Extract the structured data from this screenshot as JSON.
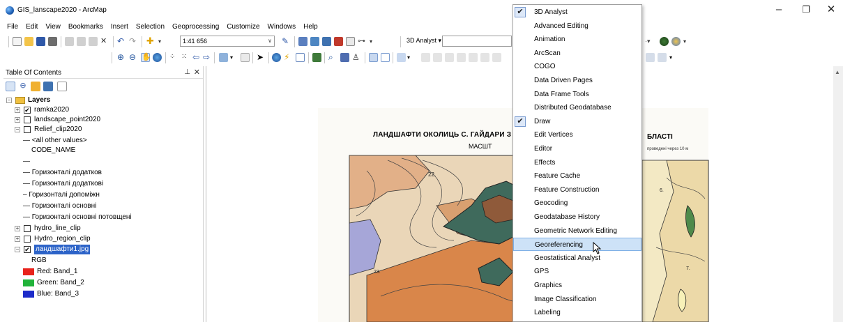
{
  "window": {
    "title": "GIS_lanscape2020 - ArcMap",
    "minimize": "–",
    "restore": "❐",
    "close": "✕"
  },
  "menubar": [
    "File",
    "Edit",
    "View",
    "Bookmarks",
    "Insert",
    "Selection",
    "Geoprocessing",
    "Customize",
    "Windows",
    "Help"
  ],
  "toolbar": {
    "scale_value": "1:41 656",
    "analyst_label": "3D Analyst ▾"
  },
  "toc": {
    "title": "Table Of Contents",
    "pin": "⊥",
    "close": "✕",
    "rows": [
      {
        "label": "Layers",
        "indent": 0,
        "expander": "−",
        "checkbox": "",
        "bold": true
      },
      {
        "label": "ramka2020",
        "indent": 1,
        "expander": "+",
        "checkbox": "✔"
      },
      {
        "label": "landscape_point2020",
        "indent": 1,
        "expander": "+",
        "checkbox": " "
      },
      {
        "label": "Relief_clip2020",
        "indent": 1,
        "expander": "−",
        "checkbox": " "
      },
      {
        "label": "— <all other values>",
        "indent": 2
      },
      {
        "label": "CODE_NAME",
        "indent": 3
      },
      {
        "label": "—",
        "indent": 2
      },
      {
        "label": "— Горизонталі додатков",
        "indent": 2
      },
      {
        "label": "— Горизонталі додаткові",
        "indent": 2
      },
      {
        "label": "– Горизонталі допоміжн",
        "indent": 2
      },
      {
        "label": "— Горизонталі основні",
        "indent": 2
      },
      {
        "label": "— Горизонталі основні потовщені",
        "indent": 2
      },
      {
        "label": "hydro_line_clip",
        "indent": 1,
        "expander": "+",
        "checkbox": " "
      },
      {
        "label": "Hydro_region_clip",
        "indent": 1,
        "expander": "+",
        "checkbox": " "
      },
      {
        "label": "ландшафти1.jpg",
        "indent": 1,
        "expander": "−",
        "checkbox": "✔",
        "selected": true
      },
      {
        "label": "RGB",
        "indent": 3
      },
      {
        "label": "Red:   Band_1",
        "indent": 2,
        "swatch": "#e8231c"
      },
      {
        "label": "Green: Band_2",
        "indent": 2,
        "swatch": "#21b33a"
      },
      {
        "label": "Blue:  Band_3",
        "indent": 2,
        "swatch": "#1d2bc9"
      }
    ]
  },
  "map": {
    "title_left": "ЛАНДШАФТИ ОКОЛИЦЬ С. ГАЙДАРИ З",
    "title_right": "БЛАСТІ",
    "subtitle": "МАСШТ",
    "note": "проведені через 10 м",
    "labels": [
      "22.",
      "23.",
      "6.",
      "7."
    ]
  },
  "dropdown": {
    "items": [
      {
        "label": "3D Analyst",
        "checked": true
      },
      {
        "label": "Advanced Editing"
      },
      {
        "label": "Animation"
      },
      {
        "label": "ArcScan"
      },
      {
        "label": "COGO"
      },
      {
        "label": "Data Driven Pages"
      },
      {
        "label": "Data Frame Tools"
      },
      {
        "label": "Distributed Geodatabase"
      },
      {
        "label": "Draw",
        "checked": true
      },
      {
        "label": "Edit Vertices"
      },
      {
        "label": "Editor"
      },
      {
        "label": "Effects"
      },
      {
        "label": "Feature Cache"
      },
      {
        "label": "Feature Construction"
      },
      {
        "label": "Geocoding"
      },
      {
        "label": "Geodatabase History"
      },
      {
        "label": "Geometric Network Editing"
      },
      {
        "label": "Georeferencing",
        "hover": true
      },
      {
        "label": "Geostatistical Analyst"
      },
      {
        "label": "GPS"
      },
      {
        "label": "Graphics"
      },
      {
        "label": "Image Classification"
      },
      {
        "label": "Labeling"
      }
    ]
  },
  "colors": {
    "selection": "#2c63c8",
    "hover": "#cde2f7",
    "map_orange": "#d9864a",
    "map_green": "#3f6a5c",
    "map_tan": "#e8cfa8",
    "map_purple": "#a6a6d8"
  }
}
